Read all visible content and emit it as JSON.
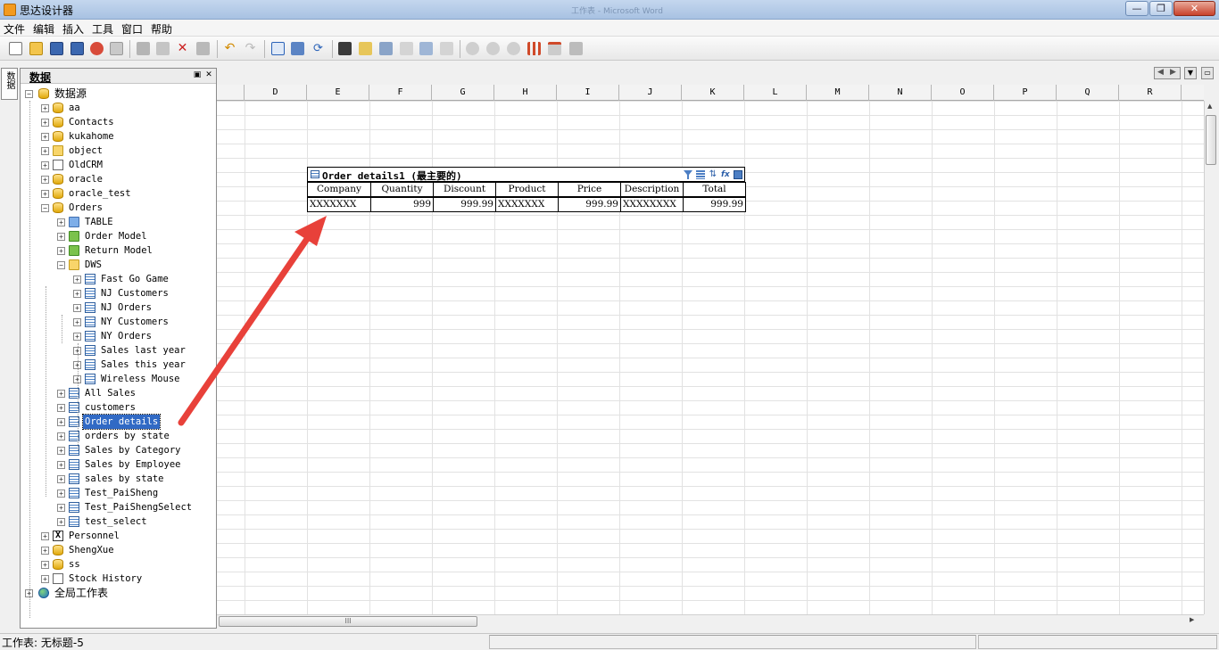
{
  "window": {
    "title": "思达设计器",
    "faded_title": "工作表 - Microsoft Word"
  },
  "menu": [
    "文件",
    "编辑",
    "插入",
    "工具",
    "窗口",
    "帮助"
  ],
  "side_tab": {
    "label": "数据"
  },
  "panel": {
    "title": "数据",
    "pin_glyph": "▣",
    "close_glyph": "✕"
  },
  "tree": [
    {
      "label": "数据源",
      "depth": 0,
      "icon": "database-icon",
      "expanded": true
    },
    {
      "label": "aa",
      "depth": 1,
      "icon": "database-icon"
    },
    {
      "label": "Contacts",
      "depth": 1,
      "icon": "contacts-icon"
    },
    {
      "label": "kukahome",
      "depth": 1,
      "icon": "database-icon"
    },
    {
      "label": "object",
      "depth": 1,
      "icon": "object-icon"
    },
    {
      "label": "OldCRM",
      "depth": 1,
      "icon": "document-icon"
    },
    {
      "label": "oracle",
      "depth": 1,
      "icon": "database-icon"
    },
    {
      "label": "oracle_test",
      "depth": 1,
      "icon": "database-icon"
    },
    {
      "label": "Orders",
      "depth": 1,
      "icon": "database-icon",
      "expanded": true
    },
    {
      "label": "TABLE",
      "depth": 2,
      "icon": "blue-folder-icon"
    },
    {
      "label": "Order Model",
      "depth": 2,
      "icon": "green-folder-icon"
    },
    {
      "label": "Return Model",
      "depth": 2,
      "icon": "green-folder-icon"
    },
    {
      "label": "DWS",
      "depth": 2,
      "icon": "folder-icon",
      "expanded": true
    },
    {
      "label": "Fast Go Game",
      "depth": 3,
      "icon": "table-icon"
    },
    {
      "label": "NJ Customers",
      "depth": 3,
      "icon": "table-icon"
    },
    {
      "label": "NJ Orders",
      "depth": 3,
      "icon": "table-icon"
    },
    {
      "label": "NY Customers",
      "depth": 3,
      "icon": "table-icon"
    },
    {
      "label": "NY Orders",
      "depth": 3,
      "icon": "table-icon"
    },
    {
      "label": "Sales last year",
      "depth": 3,
      "icon": "table-icon"
    },
    {
      "label": "Sales this year",
      "depth": 3,
      "icon": "table-icon"
    },
    {
      "label": "Wireless Mouse",
      "depth": 3,
      "icon": "table-icon"
    },
    {
      "label": "All Sales",
      "depth": 2,
      "icon": "table-icon"
    },
    {
      "label": "customers",
      "depth": 2,
      "icon": "table-icon"
    },
    {
      "label": "Order details",
      "depth": 2,
      "icon": "table-icon",
      "selected": true
    },
    {
      "label": "orders by state",
      "depth": 2,
      "icon": "table-icon"
    },
    {
      "label": "Sales by Category",
      "depth": 2,
      "icon": "table-icon"
    },
    {
      "label": "Sales by Employee",
      "depth": 2,
      "icon": "table-icon"
    },
    {
      "label": "sales by state",
      "depth": 2,
      "icon": "table-icon"
    },
    {
      "label": "Test_PaiSheng",
      "depth": 2,
      "icon": "table-icon"
    },
    {
      "label": "Test_PaiShengSelect",
      "depth": 2,
      "icon": "table-icon"
    },
    {
      "label": "test_select",
      "depth": 2,
      "icon": "table-icon"
    },
    {
      "label": "Personnel",
      "depth": 1,
      "icon": "excel-icon"
    },
    {
      "label": "ShengXue",
      "depth": 1,
      "icon": "database-icon"
    },
    {
      "label": "ss",
      "depth": 1,
      "icon": "database-icon"
    },
    {
      "label": "Stock History",
      "depth": 1,
      "icon": "document-icon"
    },
    {
      "label": "全局工作表",
      "depth": 0,
      "icon": "globe-icon"
    }
  ],
  "columns": [
    "D",
    "E",
    "F",
    "G",
    "H",
    "I",
    "J",
    "K",
    "L",
    "M",
    "N",
    "O",
    "P",
    "Q",
    "R"
  ],
  "report": {
    "title": "Order details1 (最主要的)",
    "headers": [
      "Company",
      "Quantity",
      "Discount",
      "Product",
      "Price",
      "Description",
      "Total"
    ],
    "row": [
      "XXXXXXX",
      "999",
      "999.99",
      "XXXXXXX",
      "999.99",
      "XXXXXXXX",
      "999.99"
    ]
  },
  "status": {
    "text": "工作表: 无标题-5"
  },
  "hscroll_grip": "III",
  "colors": {
    "selection": "#316ac5",
    "arrow": "#e8413a",
    "titlebar": "#b7cde8"
  }
}
